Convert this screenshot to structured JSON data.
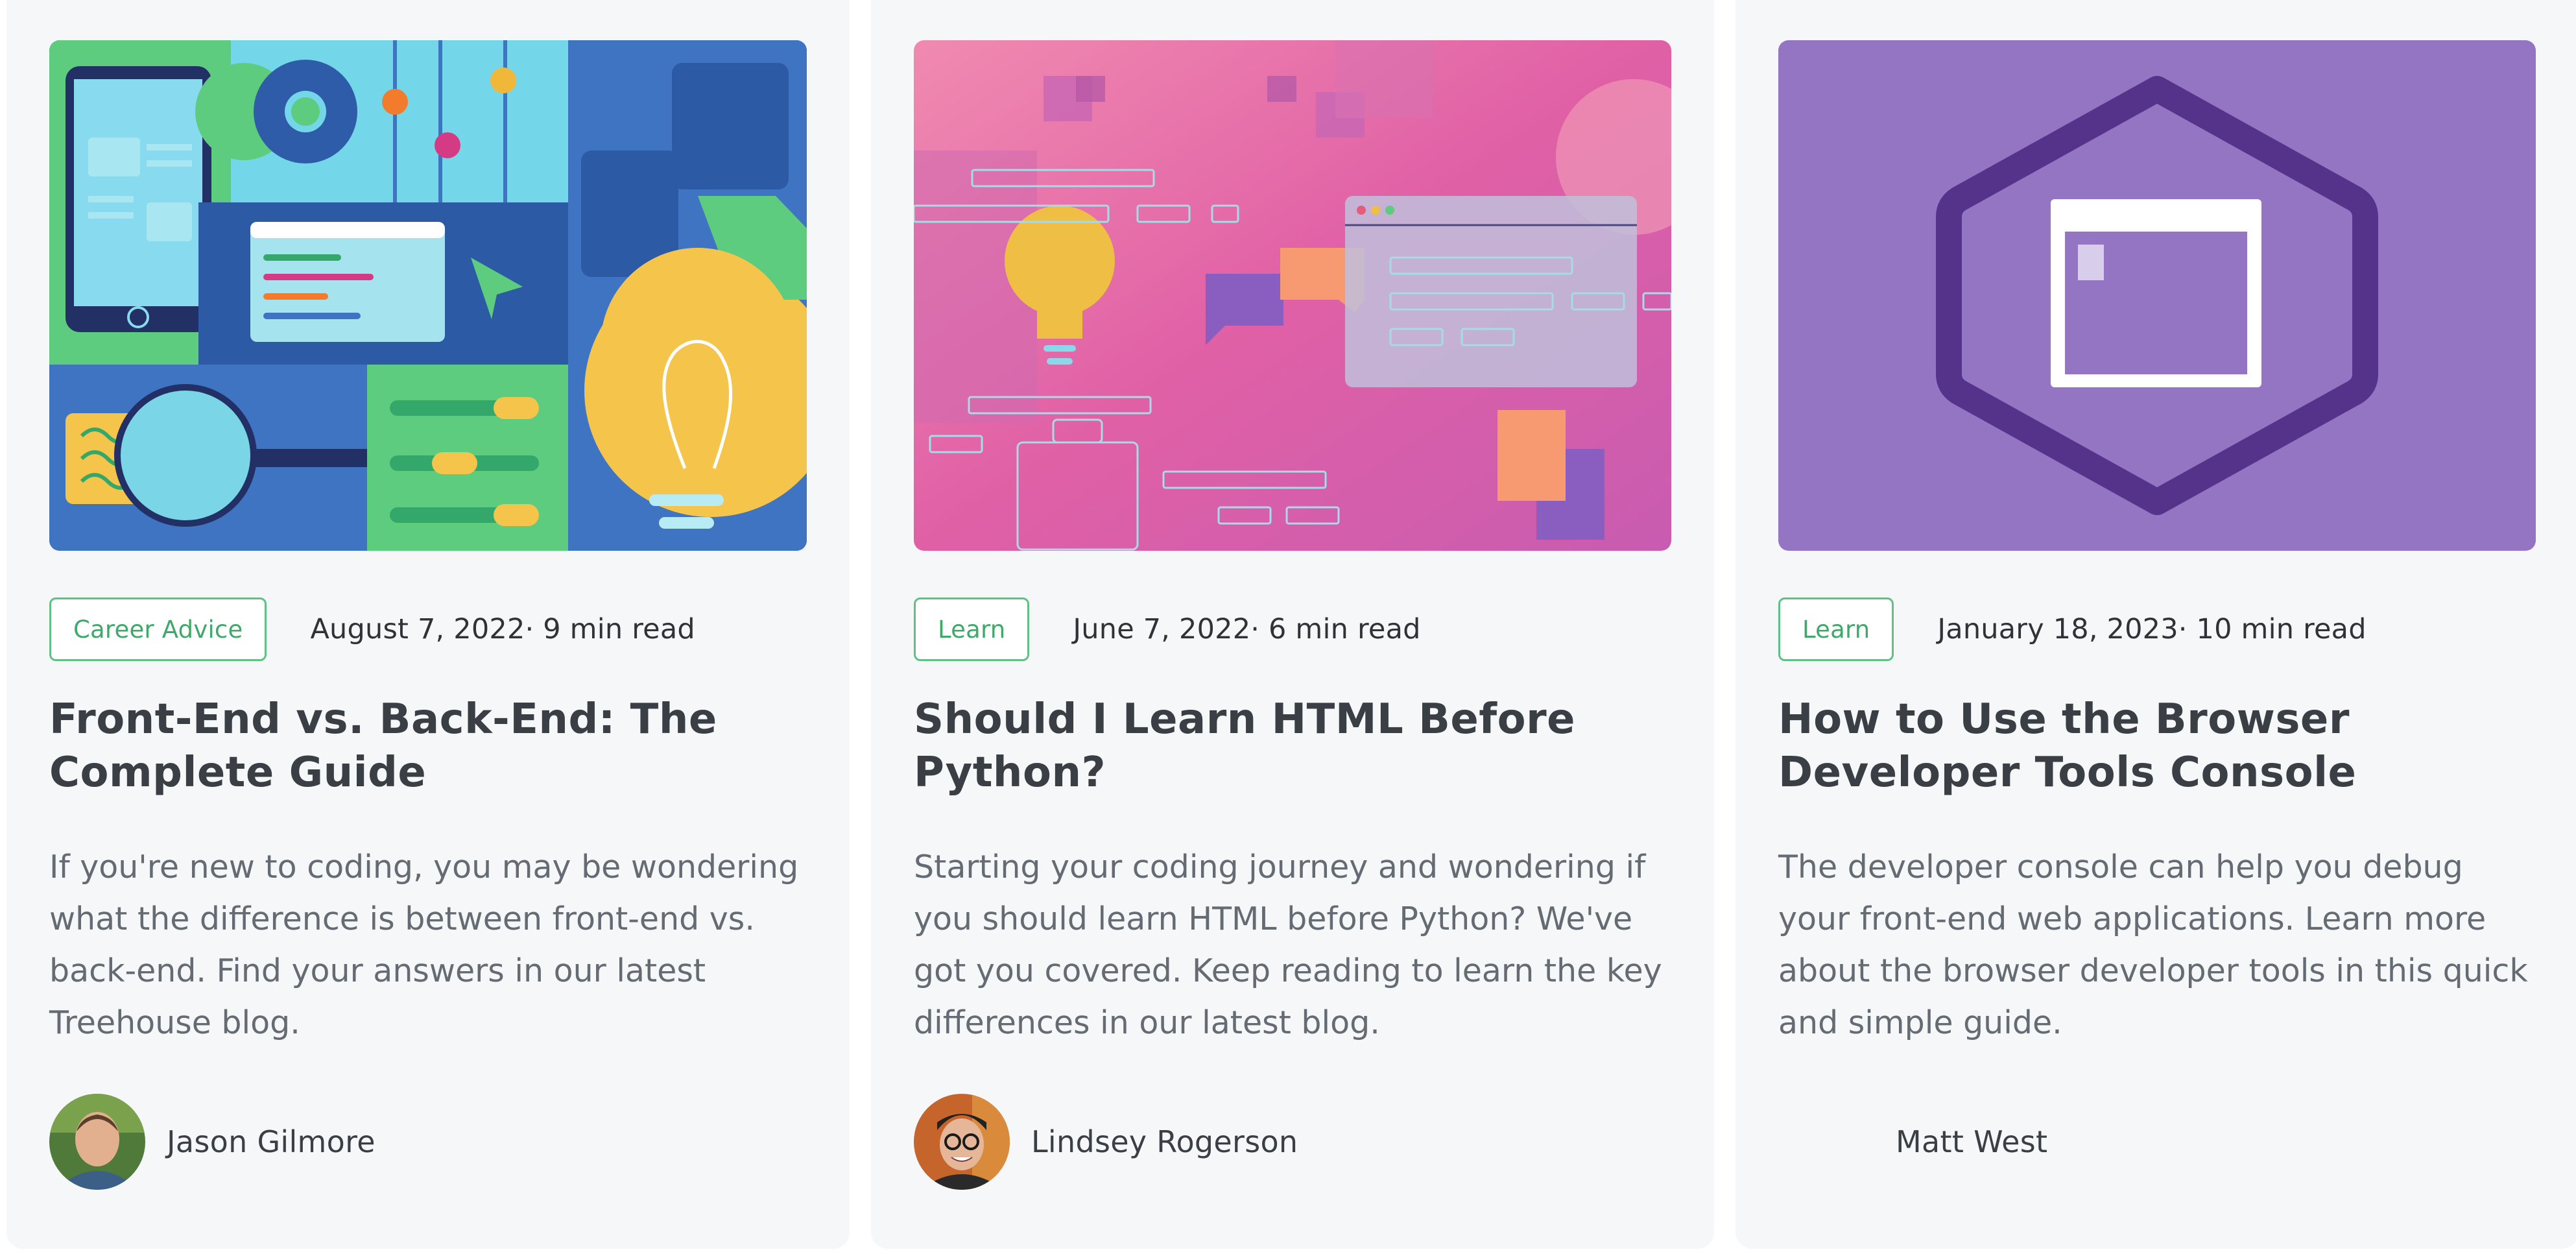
{
  "cards": [
    {
      "image_icon": "front-end-back-end-illustration",
      "tag": "Career Advice",
      "date": "August 7, 2022",
      "read_time": "· 9 min read",
      "title": "Front-End vs. Back-End: The Complete Guide",
      "excerpt": "If you're new to coding, you may be wondering what the difference is between front-end vs. back-end. Find your answers in our latest Treehouse blog.",
      "author": "Jason Gilmore"
    },
    {
      "image_icon": "lightbulb-browser-illustration",
      "tag": "Learn",
      "date": "June 7, 2022",
      "read_time": "· 6 min read",
      "title": "Should I Learn HTML Before Python?",
      "excerpt": "Starting your coding journey and wondering if you should learn HTML before Python? We've got you covered. Keep reading to learn the key differences in our latest blog.",
      "author": "Lindsey Rogerson"
    },
    {
      "image_icon": "browser-hexagon-icon",
      "tag": "Learn",
      "date": "January 18, 2023",
      "read_time": "· 10 min read",
      "title": "How to Use the Browser Developer Tools Console",
      "excerpt": "The developer console can help you debug your front-end web applications. Learn more about the browser developer tools in this quick and simple guide.",
      "author": "Matt West"
    }
  ],
  "colors": {
    "tag_border": "#5fc186",
    "tag_text": "#3fa96a",
    "card_bg": "#f6f7f9",
    "title": "#3a3f45",
    "excerpt": "#656b73",
    "purple": "#9375c4"
  }
}
